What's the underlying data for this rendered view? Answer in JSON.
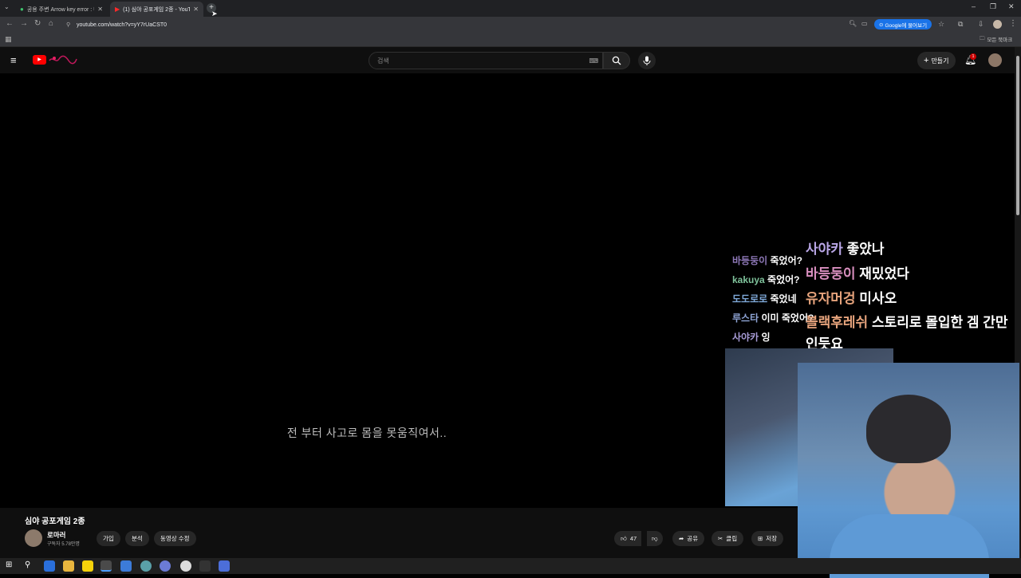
{
  "browser": {
    "tabs": [
      {
        "title": "공용 주변 Arrow key error : 네",
        "icon": "green-leaf-icon",
        "active": false
      },
      {
        "title": "(1) 심야 공포게임 2종 - YouTube",
        "icon": "youtube-icon",
        "active": true
      }
    ],
    "url": "youtube.com/watch?v=yY7rUaCST0",
    "lens_button": "Google에 물어보기",
    "bookmarks_folder": "모든 북마크"
  },
  "youtube": {
    "search_placeholder": "검색",
    "create_label": "만들기",
    "notification_count": "1"
  },
  "video": {
    "subtitle": "전 부터 사고로 몸을 못움직여서..",
    "chat_small": [
      {
        "user": "바등둥이",
        "msg": "죽었어?",
        "color": "#8e78b8"
      },
      {
        "user": "kakuya",
        "msg": "죽었어?",
        "color": "#7fc29b"
      },
      {
        "user": "도도로로",
        "msg": "죽었네",
        "color": "#7fa9d9"
      },
      {
        "user": "루스타",
        "msg": "이미 죽었어?",
        "color": "#8fa5d6"
      },
      {
        "user": "사야카",
        "msg": "잉",
        "color": "#a79bd6"
      }
    ],
    "chat_large": [
      {
        "user": "사야카",
        "msg": "좋았나",
        "color": "#b9a6e6"
      },
      {
        "user": "바등둥이",
        "msg": "재밌었다",
        "color": "#d98fbf"
      },
      {
        "user": "유자머겅",
        "msg": "미사오",
        "color": "#e6a37c"
      },
      {
        "user": "블랙후레쉬",
        "msg": "스토리로 몰입한 겜 간만",
        "color": "#e6a37c"
      }
    ],
    "chat_large_wrap": "인듯요"
  },
  "info": {
    "title": "심야 공포게임 2종",
    "channel": "로마러",
    "subscribers": "구독자 5.78만명",
    "buttons": {
      "join": "가입",
      "analytics": "분석",
      "edit": "동영상 수정"
    },
    "likes": "47",
    "share": "공유",
    "clip": "클립",
    "save": "저장"
  }
}
